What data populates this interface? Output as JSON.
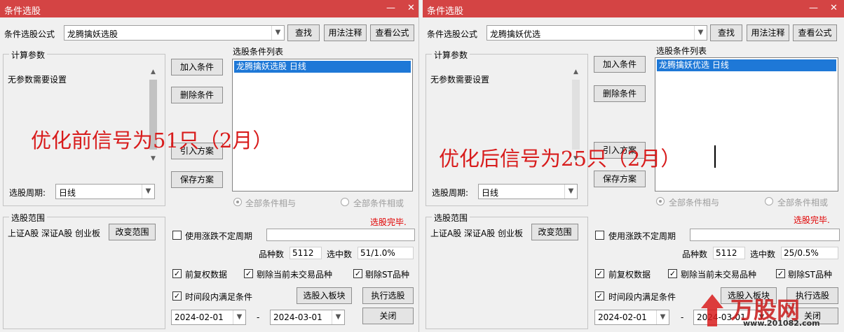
{
  "accent_colors": {
    "titlebar": "#d44444",
    "selection": "#1e78d7",
    "overlay_text": "#d81c1c",
    "status": "#e00000"
  },
  "windows": [
    {
      "title": "条件选股",
      "minimize": "—",
      "close": "✕",
      "formula_label": "条件选股公式",
      "formula_value": "龙腾擒妖选股",
      "find_button": "查找",
      "usage_button": "用法注释",
      "view_formula_button": "查看公式",
      "calc_params_title": "计算参数",
      "no_params_text": "无参数需要设置",
      "add_condition": "加入条件",
      "delete_condition": "删除条件",
      "import_plan": "引入方案",
      "save_plan": "保存方案",
      "condition_list_title": "选股条件列表",
      "condition_item": "龙腾擒妖选股  日线",
      "period_label": "选股周期:",
      "period_value": "日线",
      "radio_and": "全部条件相与",
      "radio_or": "全部条件相或",
      "scope_title": "选股范围",
      "scope_text": "上证A股 深证A股 创业板",
      "change_scope": "改变范围",
      "status": "选股完毕.",
      "use_variable_period": "使用涨跌不定周期",
      "count_label": "品种数",
      "count_value": "5112",
      "selected_label": "选中数",
      "selected_value": "51/1.0%",
      "opt_adjust": "前复权数据",
      "opt_remove_untraded": "剔除当前未交易品种",
      "opt_remove_st": "剔除ST品种",
      "opt_time_range": "时间段内满足条件",
      "to_block": "选股入板块",
      "execute": "执行选股",
      "date_from": "2024-02-01",
      "date_sep": "-",
      "date_to": "2024-03-01",
      "close_button": "关闭",
      "overlay_text": "优化前信号为51只（2月）"
    },
    {
      "title": "条件选股",
      "minimize": "—",
      "close": "✕",
      "formula_label": "条件选股公式",
      "formula_value": "龙腾擒妖优选",
      "find_button": "查找",
      "usage_button": "用法注释",
      "view_formula_button": "查看公式",
      "calc_params_title": "计算参数",
      "no_params_text": "无参数需要设置",
      "add_condition": "加入条件",
      "delete_condition": "删除条件",
      "import_plan": "引入方案",
      "save_plan": "保存方案",
      "condition_list_title": "选股条件列表",
      "condition_item": "龙腾擒妖优选  日线",
      "period_label": "选股周期:",
      "period_value": "日线",
      "radio_and": "全部条件相与",
      "radio_or": "全部条件相或",
      "scope_title": "选股范围",
      "scope_text": "上证A股 深证A股 创业板",
      "change_scope": "改变范围",
      "status": "选股完毕.",
      "use_variable_period": "使用涨跌不定周期",
      "count_label": "品种数",
      "count_value": "5112",
      "selected_label": "选中数",
      "selected_value": "25/0.5%",
      "opt_adjust": "前复权数据",
      "opt_remove_untraded": "剔除当前未交易品种",
      "opt_remove_st": "剔除ST品种",
      "opt_time_range": "时间段内满足条件",
      "to_block": "选股入板块",
      "execute": "执行选股",
      "date_from": "2024-02-01",
      "date_sep": "-",
      "date_to": "2024-03-01",
      "close_button": "关闭",
      "overlay_text": "优化后信号为25只（2月）"
    }
  ],
  "watermark": {
    "logo_text": "万股网",
    "url": "www.201082.com"
  }
}
